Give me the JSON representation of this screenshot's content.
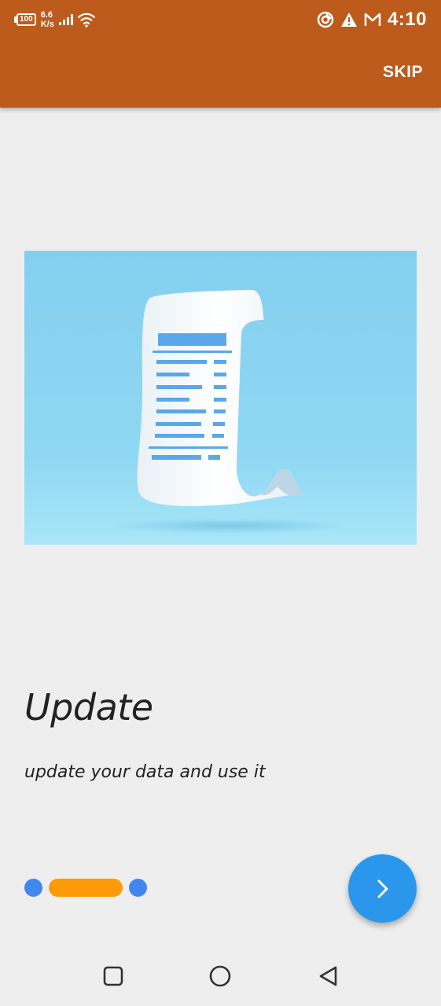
{
  "status_bar": {
    "battery": "100",
    "net_speed_value": "6.6",
    "net_speed_unit": "K/s",
    "time": "4:10",
    "icons": [
      "battery-icon",
      "signal-icon",
      "wifi-icon",
      "sync-icon",
      "alert-icon",
      "gmail-icon"
    ]
  },
  "toolbar": {
    "skip_label": "SKIP"
  },
  "onboarding": {
    "illustration": "receipt-illustration",
    "title": "Update",
    "subtitle": "update your data and use it",
    "page_index": 2,
    "page_count": 3
  },
  "next_button": {
    "icon": "chevron-right-icon"
  },
  "nav_bar": {
    "buttons": [
      "recents-button",
      "home-button",
      "back-button"
    ]
  },
  "colors": {
    "appbar": "#bc5b1b",
    "dot_inactive": "#4187f0",
    "dot_active": "#fd9a07",
    "fab": "#2b97ec",
    "background": "#eeeeef"
  }
}
